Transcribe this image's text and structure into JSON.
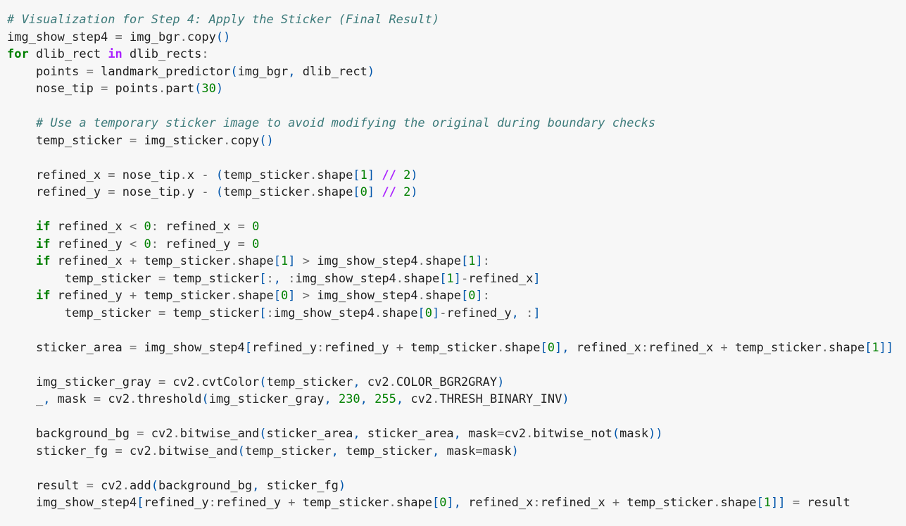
{
  "editor": {
    "language": "python",
    "lines": [
      [
        {
          "t": "comment",
          "v": "# Visualization for Step 4: Apply the Sticker (Final Result)"
        }
      ],
      [
        {
          "t": "name",
          "v": "img_show_step4 "
        },
        {
          "t": "op",
          "v": "="
        },
        {
          "t": "name",
          "v": " img_bgr"
        },
        {
          "t": "op",
          "v": "."
        },
        {
          "t": "name",
          "v": "copy"
        },
        {
          "t": "punct",
          "v": "()"
        }
      ],
      [
        {
          "t": "keyword",
          "v": "for"
        },
        {
          "t": "name",
          "v": " dlib_rect "
        },
        {
          "t": "opword",
          "v": "in"
        },
        {
          "t": "name",
          "v": " dlib_rects"
        },
        {
          "t": "op",
          "v": ":"
        }
      ],
      [
        {
          "t": "name",
          "v": "    points "
        },
        {
          "t": "op",
          "v": "="
        },
        {
          "t": "name",
          "v": " landmark_predictor"
        },
        {
          "t": "punct",
          "v": "("
        },
        {
          "t": "name",
          "v": "img_bgr"
        },
        {
          "t": "punct",
          "v": ","
        },
        {
          "t": "name",
          "v": " dlib_rect"
        },
        {
          "t": "punct",
          "v": ")"
        }
      ],
      [
        {
          "t": "name",
          "v": "    nose_tip "
        },
        {
          "t": "op",
          "v": "="
        },
        {
          "t": "name",
          "v": " points"
        },
        {
          "t": "op",
          "v": "."
        },
        {
          "t": "name",
          "v": "part"
        },
        {
          "t": "punct",
          "v": "("
        },
        {
          "t": "number",
          "v": "30"
        },
        {
          "t": "punct",
          "v": ")"
        }
      ],
      [],
      [
        {
          "t": "name",
          "v": "    "
        },
        {
          "t": "comment",
          "v": "# Use a temporary sticker image to avoid modifying the original during boundary checks"
        }
      ],
      [
        {
          "t": "name",
          "v": "    temp_sticker "
        },
        {
          "t": "op",
          "v": "="
        },
        {
          "t": "name",
          "v": " img_sticker"
        },
        {
          "t": "op",
          "v": "."
        },
        {
          "t": "name",
          "v": "copy"
        },
        {
          "t": "punct",
          "v": "()"
        }
      ],
      [],
      [
        {
          "t": "name",
          "v": "    refined_x "
        },
        {
          "t": "op",
          "v": "="
        },
        {
          "t": "name",
          "v": " nose_tip"
        },
        {
          "t": "op",
          "v": "."
        },
        {
          "t": "name",
          "v": "x "
        },
        {
          "t": "op",
          "v": "-"
        },
        {
          "t": "name",
          "v": " "
        },
        {
          "t": "punct",
          "v": "("
        },
        {
          "t": "name",
          "v": "temp_sticker"
        },
        {
          "t": "op",
          "v": "."
        },
        {
          "t": "name",
          "v": "shape"
        },
        {
          "t": "punct",
          "v": "["
        },
        {
          "t": "number",
          "v": "1"
        },
        {
          "t": "punct",
          "v": "]"
        },
        {
          "t": "name",
          "v": " "
        },
        {
          "t": "opword",
          "v": "//"
        },
        {
          "t": "name",
          "v": " "
        },
        {
          "t": "number",
          "v": "2"
        },
        {
          "t": "punct",
          "v": ")"
        }
      ],
      [
        {
          "t": "name",
          "v": "    refined_y "
        },
        {
          "t": "op",
          "v": "="
        },
        {
          "t": "name",
          "v": " nose_tip"
        },
        {
          "t": "op",
          "v": "."
        },
        {
          "t": "name",
          "v": "y "
        },
        {
          "t": "op",
          "v": "-"
        },
        {
          "t": "name",
          "v": " "
        },
        {
          "t": "punct",
          "v": "("
        },
        {
          "t": "name",
          "v": "temp_sticker"
        },
        {
          "t": "op",
          "v": "."
        },
        {
          "t": "name",
          "v": "shape"
        },
        {
          "t": "punct",
          "v": "["
        },
        {
          "t": "number",
          "v": "0"
        },
        {
          "t": "punct",
          "v": "]"
        },
        {
          "t": "name",
          "v": " "
        },
        {
          "t": "opword",
          "v": "//"
        },
        {
          "t": "name",
          "v": " "
        },
        {
          "t": "number",
          "v": "2"
        },
        {
          "t": "punct",
          "v": ")"
        }
      ],
      [],
      [
        {
          "t": "name",
          "v": "    "
        },
        {
          "t": "keyword",
          "v": "if"
        },
        {
          "t": "name",
          "v": " refined_x "
        },
        {
          "t": "op",
          "v": "<"
        },
        {
          "t": "name",
          "v": " "
        },
        {
          "t": "number",
          "v": "0"
        },
        {
          "t": "op",
          "v": ":"
        },
        {
          "t": "name",
          "v": " refined_x "
        },
        {
          "t": "op",
          "v": "="
        },
        {
          "t": "name",
          "v": " "
        },
        {
          "t": "number",
          "v": "0"
        }
      ],
      [
        {
          "t": "name",
          "v": "    "
        },
        {
          "t": "keyword",
          "v": "if"
        },
        {
          "t": "name",
          "v": " refined_y "
        },
        {
          "t": "op",
          "v": "<"
        },
        {
          "t": "name",
          "v": " "
        },
        {
          "t": "number",
          "v": "0"
        },
        {
          "t": "op",
          "v": ":"
        },
        {
          "t": "name",
          "v": " refined_y "
        },
        {
          "t": "op",
          "v": "="
        },
        {
          "t": "name",
          "v": " "
        },
        {
          "t": "number",
          "v": "0"
        }
      ],
      [
        {
          "t": "name",
          "v": "    "
        },
        {
          "t": "keyword",
          "v": "if"
        },
        {
          "t": "name",
          "v": " refined_x "
        },
        {
          "t": "op",
          "v": "+"
        },
        {
          "t": "name",
          "v": " temp_sticker"
        },
        {
          "t": "op",
          "v": "."
        },
        {
          "t": "name",
          "v": "shape"
        },
        {
          "t": "punct",
          "v": "["
        },
        {
          "t": "number",
          "v": "1"
        },
        {
          "t": "punct",
          "v": "]"
        },
        {
          "t": "name",
          "v": " "
        },
        {
          "t": "op",
          "v": ">"
        },
        {
          "t": "name",
          "v": " img_show_step4"
        },
        {
          "t": "op",
          "v": "."
        },
        {
          "t": "name",
          "v": "shape"
        },
        {
          "t": "punct",
          "v": "["
        },
        {
          "t": "number",
          "v": "1"
        },
        {
          "t": "punct",
          "v": "]"
        },
        {
          "t": "op",
          "v": ":"
        }
      ],
      [
        {
          "t": "name",
          "v": "        temp_sticker "
        },
        {
          "t": "op",
          "v": "="
        },
        {
          "t": "name",
          "v": " temp_sticker"
        },
        {
          "t": "punct",
          "v": "["
        },
        {
          "t": "op",
          "v": ":"
        },
        {
          "t": "punct",
          "v": ","
        },
        {
          "t": "name",
          "v": " "
        },
        {
          "t": "op",
          "v": ":"
        },
        {
          "t": "name",
          "v": "img_show_step4"
        },
        {
          "t": "op",
          "v": "."
        },
        {
          "t": "name",
          "v": "shape"
        },
        {
          "t": "punct",
          "v": "["
        },
        {
          "t": "number",
          "v": "1"
        },
        {
          "t": "punct",
          "v": "]"
        },
        {
          "t": "op",
          "v": "-"
        },
        {
          "t": "name",
          "v": "refined_x"
        },
        {
          "t": "punct",
          "v": "]"
        }
      ],
      [
        {
          "t": "name",
          "v": "    "
        },
        {
          "t": "keyword",
          "v": "if"
        },
        {
          "t": "name",
          "v": " refined_y "
        },
        {
          "t": "op",
          "v": "+"
        },
        {
          "t": "name",
          "v": " temp_sticker"
        },
        {
          "t": "op",
          "v": "."
        },
        {
          "t": "name",
          "v": "shape"
        },
        {
          "t": "punct",
          "v": "["
        },
        {
          "t": "number",
          "v": "0"
        },
        {
          "t": "punct",
          "v": "]"
        },
        {
          "t": "name",
          "v": " "
        },
        {
          "t": "op",
          "v": ">"
        },
        {
          "t": "name",
          "v": " img_show_step4"
        },
        {
          "t": "op",
          "v": "."
        },
        {
          "t": "name",
          "v": "shape"
        },
        {
          "t": "punct",
          "v": "["
        },
        {
          "t": "number",
          "v": "0"
        },
        {
          "t": "punct",
          "v": "]"
        },
        {
          "t": "op",
          "v": ":"
        }
      ],
      [
        {
          "t": "name",
          "v": "        temp_sticker "
        },
        {
          "t": "op",
          "v": "="
        },
        {
          "t": "name",
          "v": " temp_sticker"
        },
        {
          "t": "punct",
          "v": "["
        },
        {
          "t": "op",
          "v": ":"
        },
        {
          "t": "name",
          "v": "img_show_step4"
        },
        {
          "t": "op",
          "v": "."
        },
        {
          "t": "name",
          "v": "shape"
        },
        {
          "t": "punct",
          "v": "["
        },
        {
          "t": "number",
          "v": "0"
        },
        {
          "t": "punct",
          "v": "]"
        },
        {
          "t": "op",
          "v": "-"
        },
        {
          "t": "name",
          "v": "refined_y"
        },
        {
          "t": "punct",
          "v": ","
        },
        {
          "t": "name",
          "v": " "
        },
        {
          "t": "op",
          "v": ":"
        },
        {
          "t": "punct",
          "v": "]"
        }
      ],
      [],
      [
        {
          "t": "name",
          "v": "    sticker_area "
        },
        {
          "t": "op",
          "v": "="
        },
        {
          "t": "name",
          "v": " img_show_step4"
        },
        {
          "t": "punct",
          "v": "["
        },
        {
          "t": "name",
          "v": "refined_y"
        },
        {
          "t": "op",
          "v": ":"
        },
        {
          "t": "name",
          "v": "refined_y "
        },
        {
          "t": "op",
          "v": "+"
        },
        {
          "t": "name",
          "v": " temp_sticker"
        },
        {
          "t": "op",
          "v": "."
        },
        {
          "t": "name",
          "v": "shape"
        },
        {
          "t": "punct",
          "v": "["
        },
        {
          "t": "number",
          "v": "0"
        },
        {
          "t": "punct",
          "v": "],"
        },
        {
          "t": "name",
          "v": " refined_x"
        },
        {
          "t": "op",
          "v": ":"
        },
        {
          "t": "name",
          "v": "refined_x "
        },
        {
          "t": "op",
          "v": "+"
        },
        {
          "t": "name",
          "v": " temp_sticker"
        },
        {
          "t": "op",
          "v": "."
        },
        {
          "t": "name",
          "v": "shape"
        },
        {
          "t": "punct",
          "v": "["
        },
        {
          "t": "number",
          "v": "1"
        },
        {
          "t": "punct",
          "v": "]]"
        }
      ],
      [],
      [
        {
          "t": "name",
          "v": "    img_sticker_gray "
        },
        {
          "t": "op",
          "v": "="
        },
        {
          "t": "name",
          "v": " cv2"
        },
        {
          "t": "op",
          "v": "."
        },
        {
          "t": "name",
          "v": "cvtColor"
        },
        {
          "t": "punct",
          "v": "("
        },
        {
          "t": "name",
          "v": "temp_sticker"
        },
        {
          "t": "punct",
          "v": ","
        },
        {
          "t": "name",
          "v": " cv2"
        },
        {
          "t": "op",
          "v": "."
        },
        {
          "t": "name",
          "v": "COLOR_BGR2GRAY"
        },
        {
          "t": "punct",
          "v": ")"
        }
      ],
      [
        {
          "t": "name",
          "v": "    _"
        },
        {
          "t": "punct",
          "v": ","
        },
        {
          "t": "name",
          "v": " mask "
        },
        {
          "t": "op",
          "v": "="
        },
        {
          "t": "name",
          "v": " cv2"
        },
        {
          "t": "op",
          "v": "."
        },
        {
          "t": "name",
          "v": "threshold"
        },
        {
          "t": "punct",
          "v": "("
        },
        {
          "t": "name",
          "v": "img_sticker_gray"
        },
        {
          "t": "punct",
          "v": ","
        },
        {
          "t": "name",
          "v": " "
        },
        {
          "t": "number",
          "v": "230"
        },
        {
          "t": "punct",
          "v": ","
        },
        {
          "t": "name",
          "v": " "
        },
        {
          "t": "number",
          "v": "255"
        },
        {
          "t": "punct",
          "v": ","
        },
        {
          "t": "name",
          "v": " cv2"
        },
        {
          "t": "op",
          "v": "."
        },
        {
          "t": "name",
          "v": "THRESH_BINARY_INV"
        },
        {
          "t": "punct",
          "v": ")"
        }
      ],
      [],
      [
        {
          "t": "name",
          "v": "    background_bg "
        },
        {
          "t": "op",
          "v": "="
        },
        {
          "t": "name",
          "v": " cv2"
        },
        {
          "t": "op",
          "v": "."
        },
        {
          "t": "name",
          "v": "bitwise_and"
        },
        {
          "t": "punct",
          "v": "("
        },
        {
          "t": "name",
          "v": "sticker_area"
        },
        {
          "t": "punct",
          "v": ","
        },
        {
          "t": "name",
          "v": " sticker_area"
        },
        {
          "t": "punct",
          "v": ","
        },
        {
          "t": "name",
          "v": " mask"
        },
        {
          "t": "op",
          "v": "="
        },
        {
          "t": "name",
          "v": "cv2"
        },
        {
          "t": "op",
          "v": "."
        },
        {
          "t": "name",
          "v": "bitwise_not"
        },
        {
          "t": "punct",
          "v": "("
        },
        {
          "t": "name",
          "v": "mask"
        },
        {
          "t": "punct",
          "v": "))"
        }
      ],
      [
        {
          "t": "name",
          "v": "    sticker_fg "
        },
        {
          "t": "op",
          "v": "="
        },
        {
          "t": "name",
          "v": " cv2"
        },
        {
          "t": "op",
          "v": "."
        },
        {
          "t": "name",
          "v": "bitwise_and"
        },
        {
          "t": "punct",
          "v": "("
        },
        {
          "t": "name",
          "v": "temp_sticker"
        },
        {
          "t": "punct",
          "v": ","
        },
        {
          "t": "name",
          "v": " temp_sticker"
        },
        {
          "t": "punct",
          "v": ","
        },
        {
          "t": "name",
          "v": " mask"
        },
        {
          "t": "op",
          "v": "="
        },
        {
          "t": "name",
          "v": "mask"
        },
        {
          "t": "punct",
          "v": ")"
        }
      ],
      [],
      [
        {
          "t": "name",
          "v": "    result "
        },
        {
          "t": "op",
          "v": "="
        },
        {
          "t": "name",
          "v": " cv2"
        },
        {
          "t": "op",
          "v": "."
        },
        {
          "t": "name",
          "v": "add"
        },
        {
          "t": "punct",
          "v": "("
        },
        {
          "t": "name",
          "v": "background_bg"
        },
        {
          "t": "punct",
          "v": ","
        },
        {
          "t": "name",
          "v": " sticker_fg"
        },
        {
          "t": "punct",
          "v": ")"
        }
      ],
      [
        {
          "t": "name",
          "v": "    img_show_step4"
        },
        {
          "t": "punct",
          "v": "["
        },
        {
          "t": "name",
          "v": "refined_y"
        },
        {
          "t": "op",
          "v": ":"
        },
        {
          "t": "name",
          "v": "refined_y "
        },
        {
          "t": "op",
          "v": "+"
        },
        {
          "t": "name",
          "v": " temp_sticker"
        },
        {
          "t": "op",
          "v": "."
        },
        {
          "t": "name",
          "v": "shape"
        },
        {
          "t": "punct",
          "v": "["
        },
        {
          "t": "number",
          "v": "0"
        },
        {
          "t": "punct",
          "v": "],"
        },
        {
          "t": "name",
          "v": " refined_x"
        },
        {
          "t": "op",
          "v": ":"
        },
        {
          "t": "name",
          "v": "refined_x "
        },
        {
          "t": "op",
          "v": "+"
        },
        {
          "t": "name",
          "v": " temp_sticker"
        },
        {
          "t": "op",
          "v": "."
        },
        {
          "t": "name",
          "v": "shape"
        },
        {
          "t": "punct",
          "v": "["
        },
        {
          "t": "number",
          "v": "1"
        },
        {
          "t": "punct",
          "v": "]]"
        },
        {
          "t": "name",
          "v": " "
        },
        {
          "t": "op",
          "v": "="
        },
        {
          "t": "name",
          "v": " result"
        }
      ]
    ]
  }
}
